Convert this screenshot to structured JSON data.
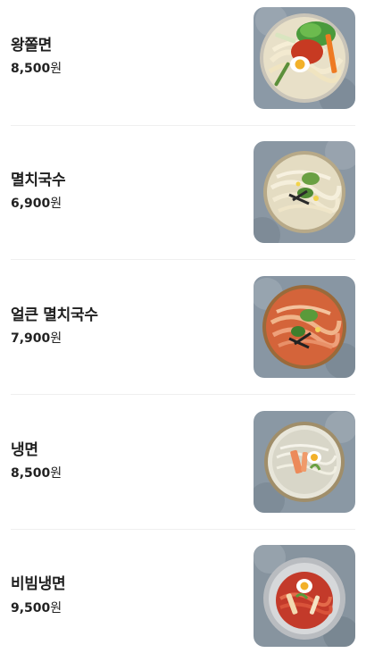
{
  "menu": {
    "items": [
      {
        "name": "왕쫄면",
        "price": "8,500",
        "currency": "원",
        "image_icon": "jjolmyeon-dish-photo"
      },
      {
        "name": "멸치국수",
        "price": "6,900",
        "currency": "원",
        "image_icon": "anchovy-noodle-dish-photo"
      },
      {
        "name": "얼큰 멸치국수",
        "price": "7,900",
        "currency": "원",
        "image_icon": "spicy-anchovy-noodle-dish-photo"
      },
      {
        "name": "냉면",
        "price": "8,500",
        "currency": "원",
        "image_icon": "cold-noodle-dish-photo"
      },
      {
        "name": "비빔냉면",
        "price": "9,500",
        "currency": "원",
        "image_icon": "bibim-cold-noodle-dish-photo"
      }
    ]
  },
  "colors": {
    "text": "#1f1f1f",
    "divider": "#efefef",
    "background": "#ffffff"
  }
}
